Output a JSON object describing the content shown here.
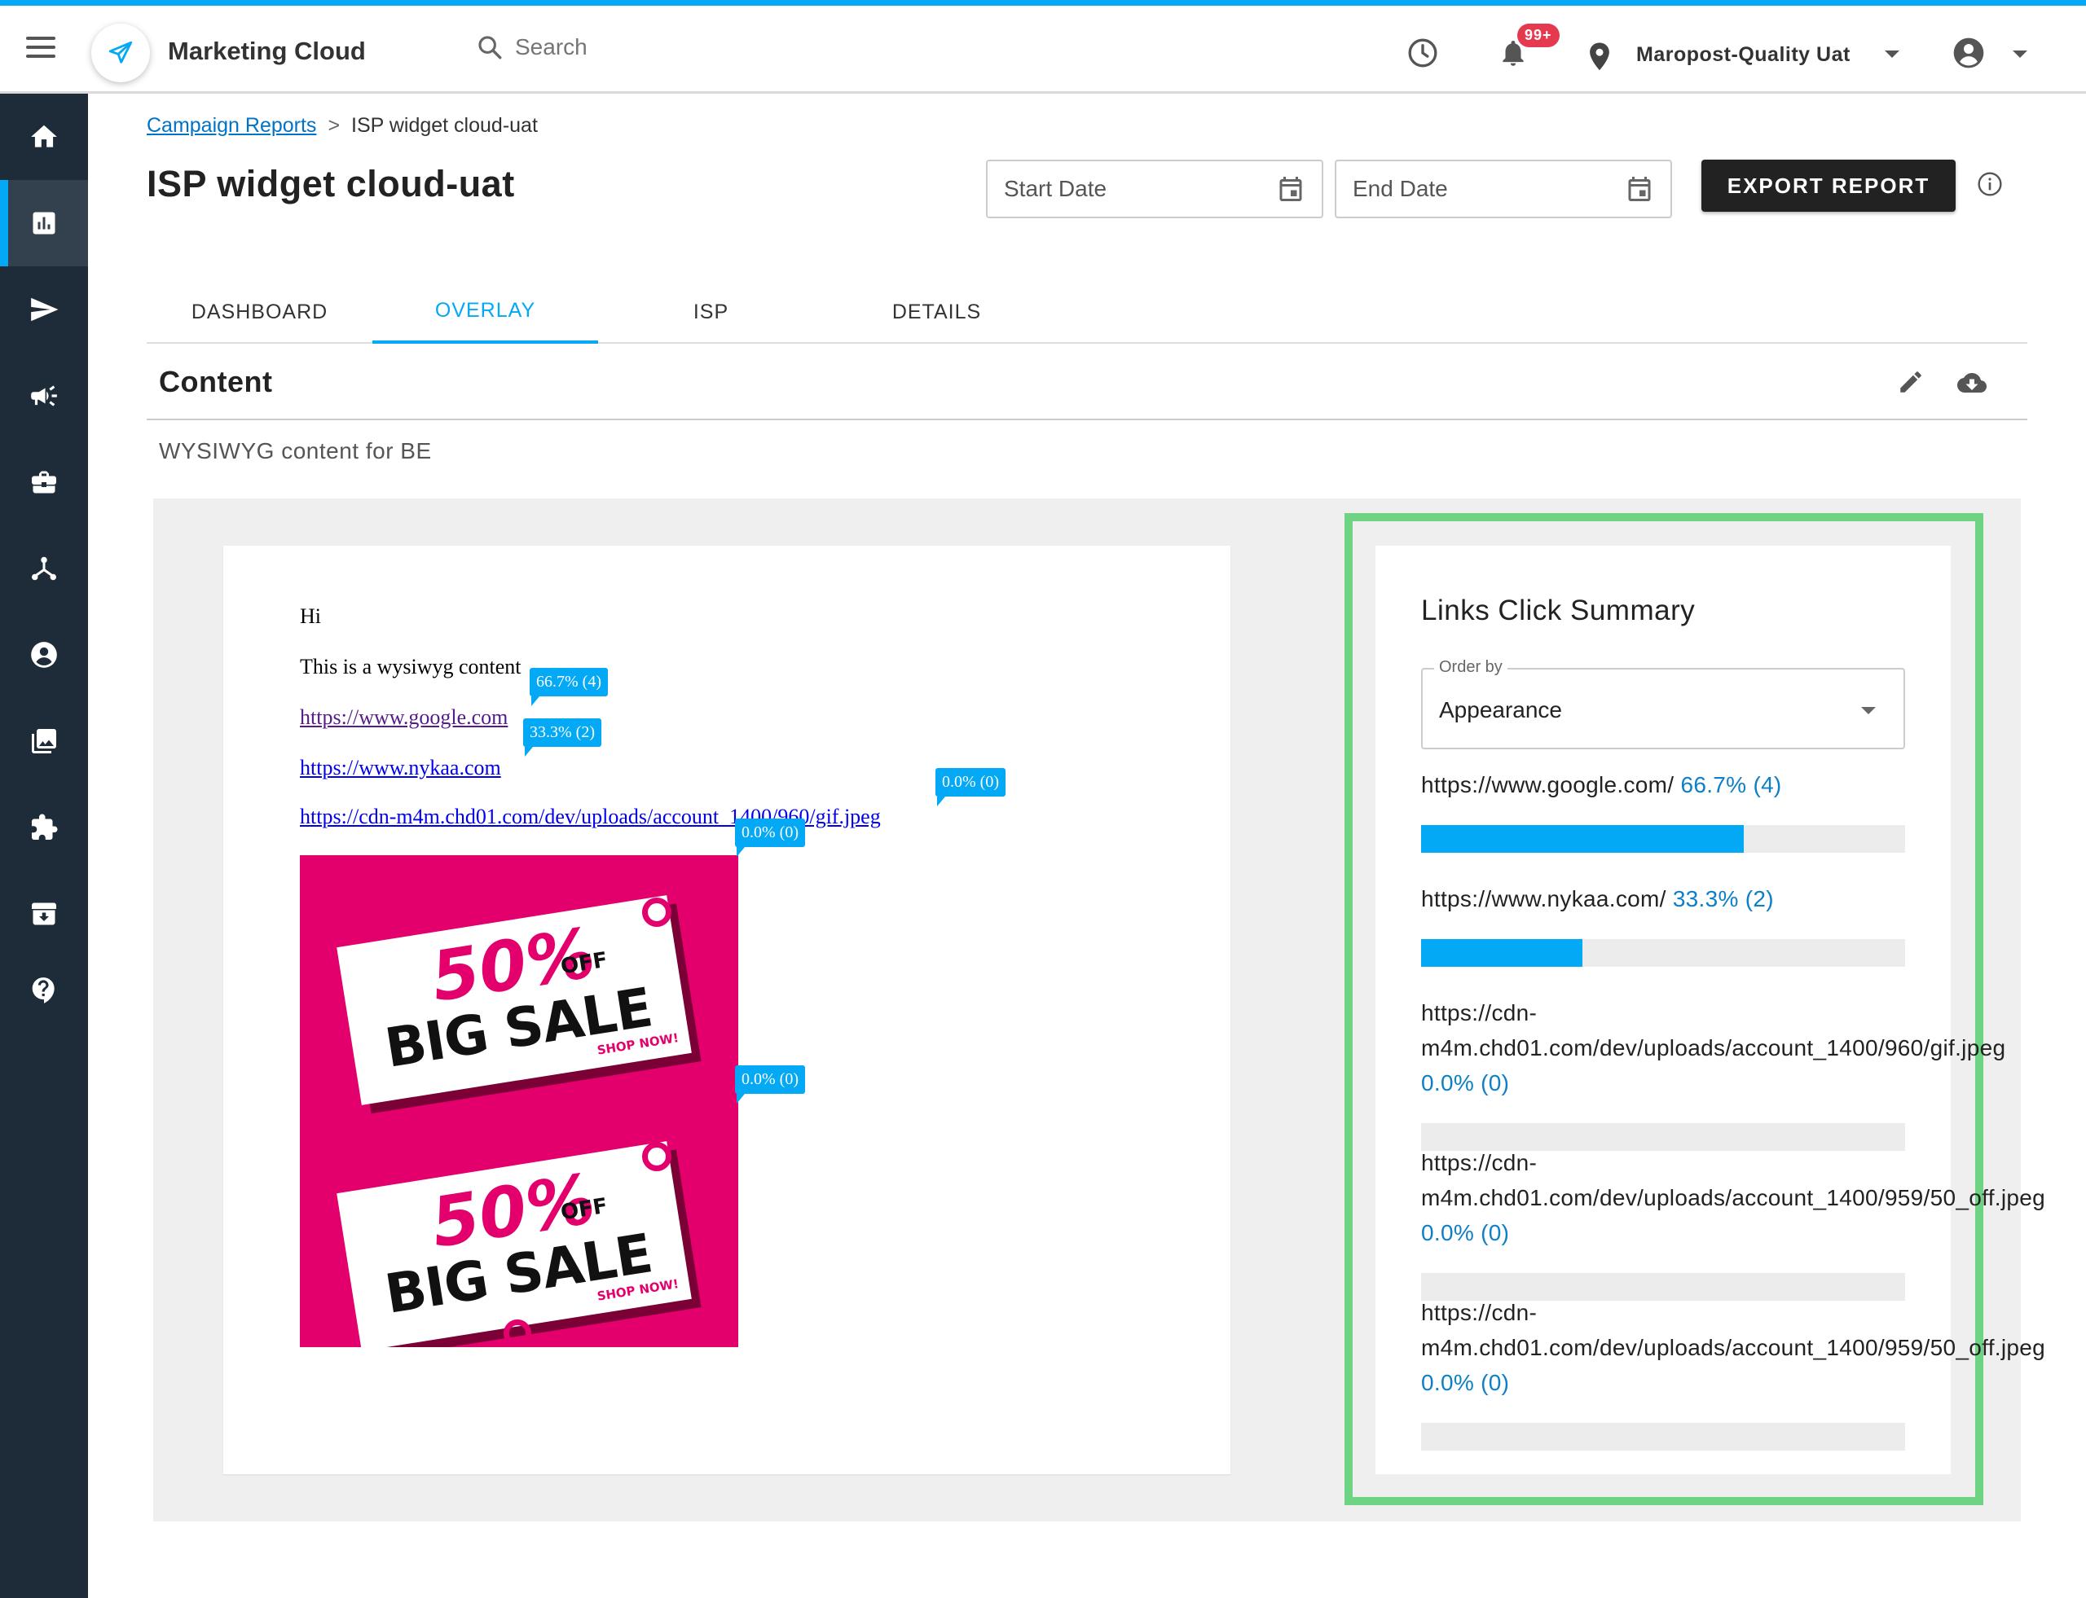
{
  "header": {
    "app_title": "Marketing Cloud",
    "search_placeholder": "Search",
    "notification_badge": "99+",
    "account_name": "Maropost-Quality Uat"
  },
  "sidebar": {
    "items": [
      {
        "icon": "home-icon"
      },
      {
        "icon": "reports-icon",
        "active": true
      },
      {
        "icon": "send-icon"
      },
      {
        "icon": "megaphone-icon"
      },
      {
        "icon": "briefcase-icon"
      },
      {
        "icon": "network-icon"
      },
      {
        "icon": "account-icon"
      },
      {
        "icon": "gallery-icon"
      },
      {
        "icon": "puzzle-icon"
      },
      {
        "icon": "archive-icon"
      },
      {
        "icon": "help-icon"
      }
    ]
  },
  "breadcrumb": {
    "parent": "Campaign Reports",
    "separator": ">",
    "current": "ISP widget cloud-uat"
  },
  "page": {
    "title": "ISP widget cloud-uat",
    "start_date_placeholder": "Start Date",
    "end_date_placeholder": "End Date",
    "export_label": "EXPORT REPORT"
  },
  "tabs": [
    {
      "label": "DASHBOARD",
      "active": false
    },
    {
      "label": "OVERLAY",
      "active": true
    },
    {
      "label": "ISP",
      "active": false
    },
    {
      "label": "DETAILS",
      "active": false
    }
  ],
  "content": {
    "title": "Content",
    "subtitle": "WYSIWYG content for BE"
  },
  "email": {
    "greeting": "Hi",
    "body": "This is a wysiwyg content",
    "links": [
      {
        "text": "https://www.google.com",
        "tip": "66.7% (4)"
      },
      {
        "text": "https://www.nykaa.com",
        "tip": "33.3% (2)"
      },
      {
        "text": "https://cdn-m4m.chd01.com/dev/uploads/account_1400/960/gif.jpeg",
        "tip": "0.0% (0)"
      }
    ],
    "image_tips": [
      "0.0% (0)",
      "0.0% (0)"
    ],
    "sale_image": {
      "percent": "50%",
      "off": "OFF",
      "headline": "BIG SALE",
      "cta": "SHOP NOW!"
    }
  },
  "summary": {
    "title": "Links Click Summary",
    "order_label": "Order by",
    "order_value": "Appearance",
    "items": [
      {
        "url": "https://www.google.com/",
        "stat": "66.7% (4)",
        "ratio": 0.667
      },
      {
        "url": "https://www.nykaa.com/",
        "stat": "33.3% (2)",
        "ratio": 0.333
      },
      {
        "url": "https://cdn-m4m.chd01.com/dev/uploads/account_1400/960/gif.jpeg",
        "stat": "0.0% (0)",
        "ratio": 0
      },
      {
        "url": "https://cdn-m4m.chd01.com/dev/uploads/account_1400/959/50_off.jpeg",
        "stat": "0.0% (0)",
        "ratio": 0
      },
      {
        "url": "https://cdn-m4m.chd01.com/dev/uploads/account_1400/959/50_off.jpeg",
        "stat": "0.0% (0)",
        "ratio": 0
      }
    ]
  },
  "colors": {
    "accent": "#03a9f4",
    "sidebar": "#1e2c3a",
    "highlight_frame": "#6fd384",
    "sale_pink": "#e3006d"
  }
}
